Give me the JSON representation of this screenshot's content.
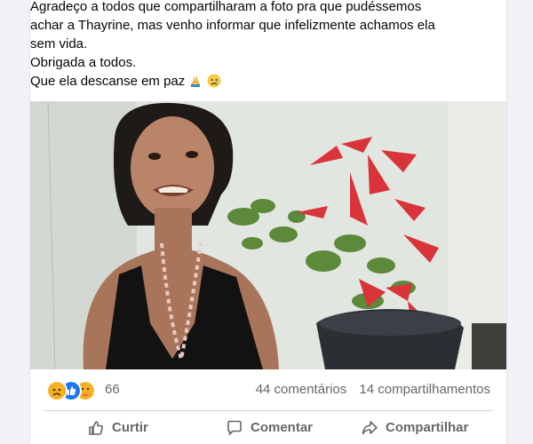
{
  "post": {
    "text_line_1": "Agradeço a todos que compartilharam a foto pra que pudéssemos",
    "text_line_2": "achar a Thayrine, mas venho informar que infelizmente achamos ela",
    "text_line_3": "sem vida.",
    "text_line_4": "Obrigada a todos.",
    "text_line_5": "Que ela descanse em paz"
  },
  "stats": {
    "reaction_count": "66",
    "comments": "44 comentários",
    "shares": "14 compartilhamentos"
  },
  "actions": {
    "like": "Curtir",
    "comment": "Comentar",
    "share": "Compartilhar"
  },
  "colors": {
    "card_bg": "#ffffff",
    "page_bg": "#f0f2f5",
    "meta_text": "#65676b",
    "like_blue": "#1877f2",
    "sad_yellow": "#f7b125"
  },
  "icons": [
    "praying-hands-icon",
    "sad-face-icon",
    "sad-reaction-icon",
    "like-reaction-icon",
    "care-reaction-icon",
    "thumbs-up-icon",
    "comment-icon",
    "share-icon"
  ]
}
